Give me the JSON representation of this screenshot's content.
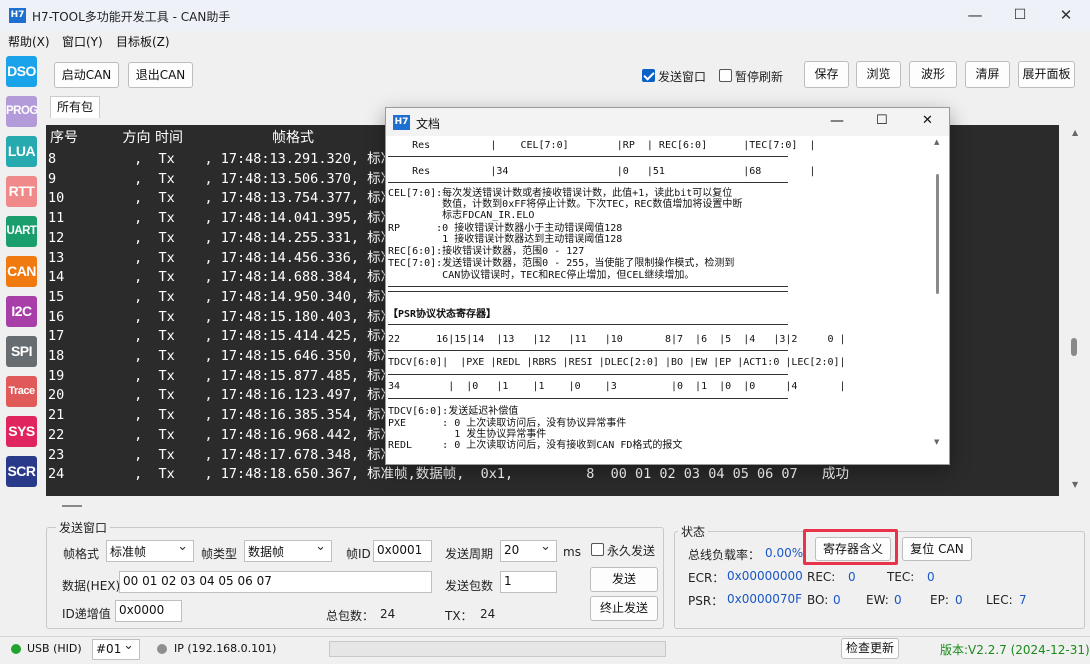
{
  "app": {
    "logo": "H7",
    "title": "H7-TOOL多功能开发工具 - CAN助手",
    "min": "—",
    "max": "☐",
    "close": "✕"
  },
  "menu": [
    "帮助(X)",
    "窗口(Y)",
    "目标板(Z)"
  ],
  "sidebar": [
    {
      "label": "DSO",
      "color": "#1aa3e8"
    },
    {
      "label": "PROG",
      "color": "#b39ad8"
    },
    {
      "label": "LUA",
      "color": "#27a9b0"
    },
    {
      "label": "RTT",
      "color": "#f08a8a"
    },
    {
      "label": "UART",
      "color": "#1b9e6e"
    },
    {
      "label": "CAN",
      "color": "#f07a10"
    },
    {
      "label": "I2C",
      "color": "#a83fa8"
    },
    {
      "label": "SPI",
      "color": "#666c70"
    },
    {
      "label": "Trace",
      "color": "#e05a5a"
    },
    {
      "label": "SYS",
      "color": "#e0245e"
    },
    {
      "label": "SCR",
      "color": "#2a3a8a"
    }
  ],
  "toolbar": {
    "start": "启动CAN",
    "stop": "退出CAN",
    "send_window": "发送窗口",
    "pause_refresh": "暂停刷新",
    "save": "保存",
    "browse": "浏览",
    "wave": "波形",
    "clear": "清屏",
    "expand": "展开面板"
  },
  "tab": "所有包",
  "terminal": {
    "header": "序号          方向 时间                    帧格式",
    "rows": [
      {
        "n": "8",
        "t": "17:48:13.291.320"
      },
      {
        "n": "9",
        "t": "17:48:13.506.370"
      },
      {
        "n": "10",
        "t": "17:48:13.754.377"
      },
      {
        "n": "11",
        "t": "17:48:14.041.395"
      },
      {
        "n": "12",
        "t": "17:48:14.255.331"
      },
      {
        "n": "13",
        "t": "17:48:14.456.336"
      },
      {
        "n": "14",
        "t": "17:48:14.688.384"
      },
      {
        "n": "15",
        "t": "17:48:14.950.340"
      },
      {
        "n": "16",
        "t": "17:48:15.180.403"
      },
      {
        "n": "17",
        "t": "17:48:15.414.425"
      },
      {
        "n": "18",
        "t": "17:48:15.646.350"
      },
      {
        "n": "19",
        "t": "17:48:15.877.485"
      },
      {
        "n": "20",
        "t": "17:48:16.123.497"
      },
      {
        "n": "21",
        "t": "17:48:16.385.354"
      },
      {
        "n": "22",
        "t": "17:48:16.968.442"
      },
      {
        "n": "23",
        "t": "17:48:17.678.348"
      },
      {
        "n": "24",
        "t": "17:48:18.650.367"
      }
    ],
    "dir": "Tx",
    "fmt": "标准帧",
    "last_tail": "数据帧,  0x1,         8  00 01 02 03 04 05 06 07   成功"
  },
  "doc": {
    "icon": "H7",
    "title": "文档",
    "lines": [
      "    Res          |    CEL[7:0]        |RP  | REC[6:0]      |TEC[7:0]  |",
      "",
      "    Res          |34                  |0   |51             |68        |",
      "CEL[7:0]:每次发送错误计数或者接收错误计数，此值+1，读此bit可以复位",
      "         数值，计数到0xFF将停止计数。下次TEC，REC数值增加将设置中断",
      "         标志FDCAN_IR.ELO",
      "RP      :0 接收错误计数器小于主动错误阈值128",
      "         1 接收错误计数器达到主动错误阈值128",
      "REC[6:0]:接收错误计数器，范围0 - 127",
      "TEC[7:0]:发送错误计数器，范围0 - 255，当使能了限制操作模式，检测到",
      "         CAN协议错误时，TEC和REC停止增加，但CEL继续增加。",
      "【PSR协议状态寄存器】",
      "22      16|15|14  |13   |12   |11   |10       8|7  |6  |5  |4   |3|2     0 |",
      "TDCV[6:0]|  |PXE |REDL |RBRS |RESI |DLEC[2:0] |BO |EW |EP |ACT1:0 |LEC[2:0]|",
      "34        |  |0   |1    |1    |0    |3         |0  |1  |0  |0     |4       |",
      "TDCV[6:0]:发送延迟补偿值",
      "PXE      : 0 上次读取访问后，没有协议异常事件",
      "           1 发生协议异常事件",
      "REDL     : 0 上次读取访问后，没有接收到CAN FD格式的报文"
    ]
  },
  "send": {
    "group": "发送窗口",
    "frame_format_label": "帧格式",
    "frame_format": "标准帧",
    "frame_type_label": "帧类型",
    "frame_type": "数据帧",
    "id_label": "帧ID",
    "id": "0x0001",
    "period_label": "发送周期",
    "period": "20",
    "period_unit": "ms",
    "forever": "永久发送",
    "data_label": "数据(HEX)",
    "data": "00 01 02 03 04 05 06 07",
    "count_label": "发送包数",
    "count": "1",
    "send": "发送",
    "id_inc_label": "ID递增值",
    "id_inc": "0x0000",
    "total_label": "总包数：",
    "total": "24",
    "tx_label": "TX：",
    "tx": "24",
    "stop": "终止发送"
  },
  "status": {
    "group": "状态",
    "bus_load_label": "总线负载率：",
    "bus_load": "0.00%",
    "reg_meaning": "寄存器含义",
    "reset_can": "复位 CAN",
    "ecr_label": "ECR：",
    "ecr": "0x00000000",
    "rec_label": "REC:",
    "rec": "0",
    "tec_label": "TEC:",
    "tec": "0",
    "psr_label": "PSR：",
    "psr": "0x0000070F",
    "bo_label": "BO:",
    "bo": "0",
    "ew_label": "EW:",
    "ew": "0",
    "ep_label": "EP:",
    "ep": "0",
    "lec_label": "LEC:",
    "lec": "7",
    "highlight_color": "#e8334a"
  },
  "statusbar": {
    "usb": "USB (HID)",
    "port": "#01",
    "ip": "IP (192.168.0.101)",
    "check_update": "检查更新",
    "version": "版本:V2.2.7 (2024-12-31)"
  }
}
